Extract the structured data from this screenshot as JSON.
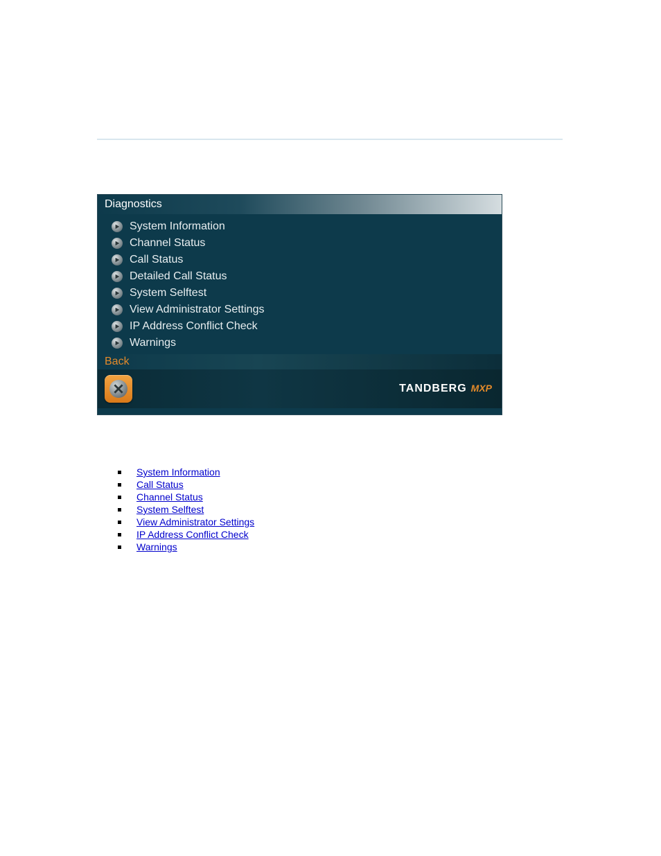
{
  "screenshot": {
    "title": "Diagnostics",
    "menu_items": [
      "System Information",
      "Channel Status",
      "Call Status",
      "Detailed Call Status",
      "System Selftest",
      "View Administrator Settings",
      "IP Address Conflict Check",
      "Warnings"
    ],
    "back_label": "Back",
    "brand_main": "TANDBERG",
    "brand_sub": "MXP"
  },
  "links": [
    "System Information",
    "Call Status",
    "Channel Status",
    "System Selftest",
    "View Administrator Settings",
    "IP Address Conflict Check",
    "Warnings"
  ]
}
